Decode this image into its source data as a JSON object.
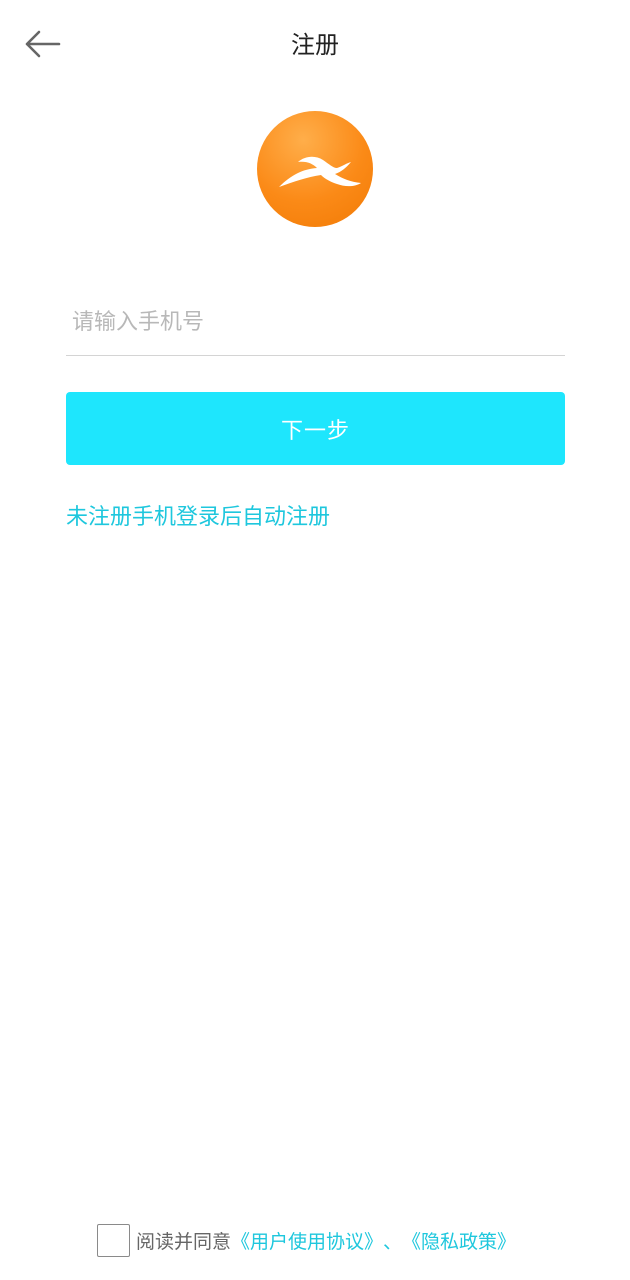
{
  "header": {
    "title": "注册",
    "back_icon": "back-arrow-icon"
  },
  "logo": {
    "icon": "app-logo",
    "colors": [
      "#ffae4a",
      "#f17a05"
    ]
  },
  "form": {
    "phone_placeholder": "请输入手机号",
    "phone_value": "",
    "next_label": "下一步",
    "hint": "未注册手机登录后自动注册"
  },
  "footer": {
    "agree_checked": false,
    "agree_text": "阅读并同意",
    "user_agreement": "《用户使用协议》",
    "separator": "、",
    "privacy_policy": "《隐私政策》"
  },
  "colors": {
    "accent": "#1ee6fd",
    "link": "#1ec7dd",
    "logo": "#f98612"
  }
}
